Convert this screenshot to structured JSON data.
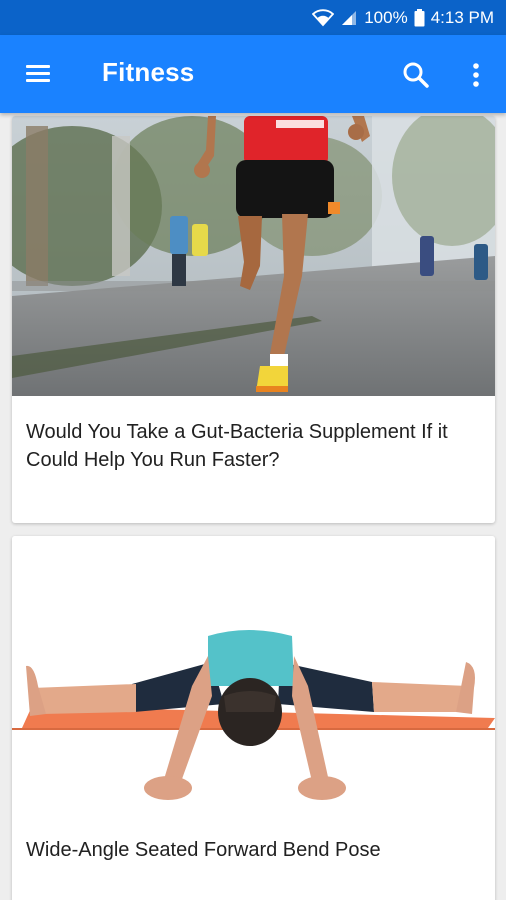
{
  "status_bar": {
    "battery": "100%",
    "time": "4:13 PM"
  },
  "app_bar": {
    "title": "Fitness",
    "menu_icon": "hamburger-menu-icon",
    "search_icon": "search-icon",
    "more_icon": "more-vert-icon"
  },
  "articles": [
    {
      "title": "Would You Take a Gut-Bacteria Supplement If it Could Help You Run Faster?",
      "image": "runner-on-road-photo"
    },
    {
      "title": "Wide-Angle Seated Forward Bend Pose",
      "image": "yoga-forward-bend-photo"
    }
  ],
  "colors": {
    "status_bar": "#0b63c9",
    "app_bar": "#1a82ff",
    "background": "#eeeeee"
  }
}
